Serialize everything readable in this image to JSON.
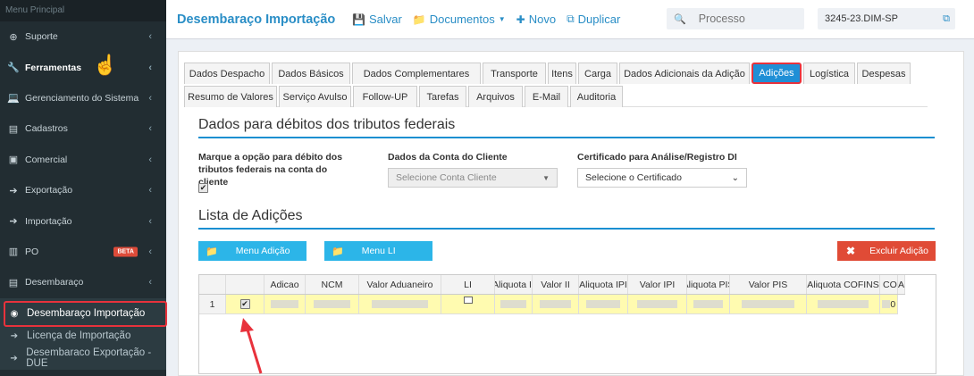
{
  "sidebar": {
    "header": "Menu Principal",
    "items": [
      {
        "label": "Suporte",
        "icon": "circle-plus-icon",
        "glyph": "⊕",
        "bold": false
      },
      {
        "label": "Ferramentas",
        "icon": "wrench-icon",
        "glyph": "🔧",
        "bold": true
      },
      {
        "label": "Gerenciamento do Sistema",
        "icon": "laptop-icon",
        "glyph": "💻",
        "bold": false
      },
      {
        "label": "Cadastros",
        "icon": "book-icon",
        "glyph": "▤",
        "bold": false
      },
      {
        "label": "Comercial",
        "icon": "briefcase-icon",
        "glyph": "▣",
        "bold": false
      },
      {
        "label": "Exportação",
        "icon": "circle-arrow-icon",
        "glyph": "➔",
        "bold": false
      },
      {
        "label": "Importação",
        "icon": "circle-arrow-icon",
        "glyph": "➔",
        "bold": false
      },
      {
        "label": "PO",
        "icon": "bar-chart-icon",
        "glyph": "▥",
        "bold": false,
        "badge": "BETA"
      },
      {
        "label": "Desembaraço",
        "icon": "book-icon",
        "glyph": "▤",
        "bold": false
      }
    ],
    "subitems": [
      {
        "label": "Desembaraço Importação",
        "active": true
      },
      {
        "label": "Licença de Importação",
        "active": false
      },
      {
        "label": "Desembaraco Exportação - DUE",
        "active": false
      }
    ]
  },
  "topbar": {
    "title": "Desembaraço Importação",
    "buttons": [
      {
        "label": "Salvar",
        "icon": "save-icon",
        "glyph": "💾"
      },
      {
        "label": "Documentos",
        "icon": "folder-icon",
        "glyph": "📁",
        "dropdown": true
      },
      {
        "label": "Novo",
        "icon": "plus-icon",
        "glyph": "✚"
      },
      {
        "label": "Duplicar",
        "icon": "copy-icon",
        "glyph": "⧉"
      }
    ],
    "search_placeholder": "Processo",
    "process_id": "3245-23.DIM-SP"
  },
  "tabs": {
    "row1": [
      "Dados Despacho",
      "Dados Básicos",
      "Dados Complementares",
      "Transporte",
      "Itens",
      "Carga",
      "Dados Adicionais da Adição",
      "Adições",
      "Logística",
      "Despesas"
    ],
    "row2": [
      "Resumo de Valores",
      "Serviço Avulso",
      "Follow-UP",
      "Tarefas",
      "Arquivos",
      "E-Mail",
      "Auditoria"
    ],
    "active": "Adições"
  },
  "debitos": {
    "title": "Dados para débitos dos tributos federais",
    "checkbox_label": "Marque a opção para débito dos tributos federais na conta do cliente",
    "checkbox_checked": true,
    "conta_label": "Dados da Conta do Cliente",
    "conta_placeholder": "Selecione Conta Cliente",
    "cert_label": "Certificado para Análise/Registro DI",
    "cert_placeholder": "Selecione o Certificado"
  },
  "adicoes": {
    "title": "Lista de Adições",
    "menu_adicao": "Menu Adição",
    "menu_li": "Menu LI",
    "excluir": "Excluir Adição",
    "columns": [
      "Adicao",
      "NCM",
      "Valor Aduaneiro",
      "LI",
      "Aliquota II",
      "Valor II",
      "Aliquota IPI",
      "Valor IPI",
      "Aliquota PIS",
      "Valor PIS",
      "Aliquota COFINS",
      "Valor COFINS",
      "A"
    ],
    "rows": [
      {
        "row_number": "1",
        "selected": true,
        "cofins_tail": "0"
      }
    ]
  },
  "colors": {
    "accent": "#2a8ec6",
    "highlight_red": "#e8323c",
    "sidebar_bg": "#222d32",
    "row_highlight": "#fffbb0"
  }
}
